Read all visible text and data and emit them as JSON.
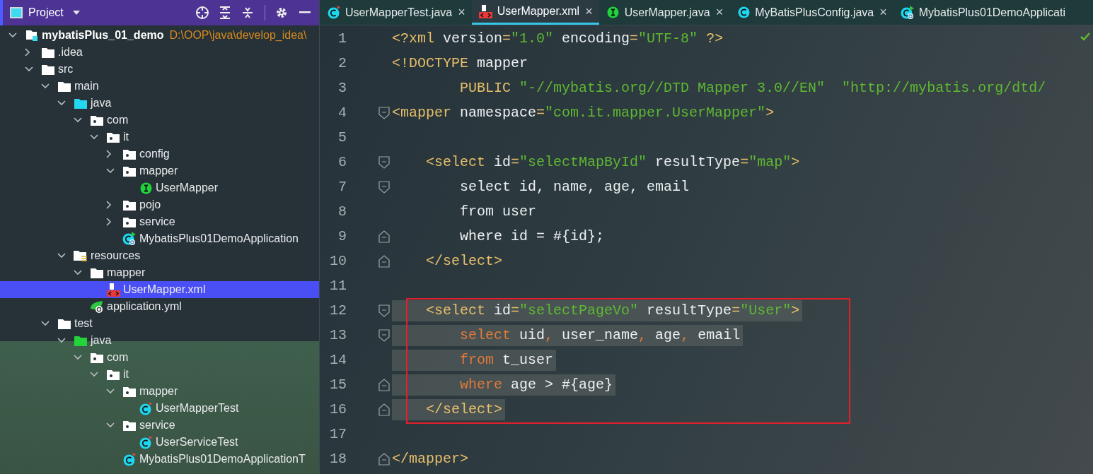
{
  "project_panel": {
    "title": "Project",
    "tree": [
      {
        "label": "mybatisPlus_01_demo",
        "path": "D:\\OOP\\java\\develop_idea\\",
        "kind": "project",
        "expanded": true,
        "selected": false,
        "children": [
          {
            "label": ".idea",
            "kind": "folder",
            "expanded": false,
            "selected": false
          },
          {
            "label": "src",
            "kind": "folder",
            "expanded": true,
            "selected": false,
            "children": [
              {
                "label": "main",
                "kind": "folder",
                "expanded": true,
                "selected": false,
                "children": [
                  {
                    "label": "java",
                    "kind": "source",
                    "expanded": true,
                    "selected": false,
                    "children": [
                      {
                        "label": "com",
                        "kind": "package",
                        "expanded": true,
                        "selected": false,
                        "children": [
                          {
                            "label": "it",
                            "kind": "package",
                            "expanded": true,
                            "selected": false,
                            "children": [
                              {
                                "label": "config",
                                "kind": "package",
                                "expanded": false,
                                "selected": false
                              },
                              {
                                "label": "mapper",
                                "kind": "package",
                                "expanded": true,
                                "selected": false,
                                "children": [
                                  {
                                    "label": "UserMapper",
                                    "kind": "interface",
                                    "selected": false
                                  }
                                ]
                              },
                              {
                                "label": "pojo",
                                "kind": "package",
                                "expanded": false,
                                "selected": false
                              },
                              {
                                "label": "service",
                                "kind": "package",
                                "expanded": false,
                                "selected": false
                              },
                              {
                                "label": "MybatisPlus01DemoApplication",
                                "kind": "app",
                                "selected": false
                              }
                            ]
                          }
                        ]
                      }
                    ]
                  },
                  {
                    "label": "resources",
                    "kind": "resources",
                    "expanded": true,
                    "selected": false,
                    "children": [
                      {
                        "label": "mapper",
                        "kind": "folder",
                        "expanded": true,
                        "selected": false,
                        "children": [
                          {
                            "label": "UserMapper.xml",
                            "kind": "xml",
                            "selected": true
                          }
                        ]
                      },
                      {
                        "label": "application.yml",
                        "kind": "yml",
                        "selected": false
                      }
                    ]
                  }
                ]
              },
              {
                "label": "test",
                "kind": "folder",
                "expanded": true,
                "selected": false,
                "children": [
                  {
                    "label": "java",
                    "kind": "test",
                    "expanded": true,
                    "selected": false,
                    "children": [
                      {
                        "label": "com",
                        "kind": "package",
                        "expanded": true,
                        "selected": false,
                        "children": [
                          {
                            "label": "it",
                            "kind": "package",
                            "expanded": true,
                            "selected": false,
                            "children": [
                              {
                                "label": "mapper",
                                "kind": "package",
                                "expanded": true,
                                "selected": false,
                                "children": [
                                  {
                                    "label": "UserMapperTest",
                                    "kind": "testclass",
                                    "selected": false
                                  }
                                ]
                              },
                              {
                                "label": "service",
                                "kind": "package",
                                "expanded": true,
                                "selected": false,
                                "children": [
                                  {
                                    "label": "UserServiceTest",
                                    "kind": "testclass",
                                    "selected": false
                                  }
                                ]
                              },
                              {
                                "label": "MybatisPlus01DemoApplicationT",
                                "kind": "testclass",
                                "selected": false
                              }
                            ]
                          }
                        ]
                      }
                    ]
                  }
                ]
              }
            ]
          }
        ]
      }
    ]
  },
  "editor_tabs": [
    {
      "label": "UserMapperTest.java",
      "kind": "testclass",
      "close": "×",
      "selected": false
    },
    {
      "label": "UserMapper.xml",
      "kind": "xml",
      "close": "×",
      "selected": true
    },
    {
      "label": "UserMapper.java",
      "kind": "interface",
      "close": "×",
      "selected": false
    },
    {
      "label": "MyBatisPlusConfig.java",
      "kind": "class",
      "close": "×",
      "selected": false
    },
    {
      "label": "MybatisPlus01DemoApplicati",
      "kind": "app",
      "selected": false
    }
  ],
  "editor": {
    "lines": [
      {
        "number": "1",
        "highlighted": false,
        "tokens": [
          {
            "kind": "tag",
            "text": "<?xml "
          },
          {
            "kind": "attr",
            "text": "version"
          },
          {
            "kind": "tag",
            "text": "="
          },
          {
            "kind": "str",
            "text": "\"1.0\""
          },
          {
            "kind": "attr",
            "text": " encoding"
          },
          {
            "kind": "tag",
            "text": "="
          },
          {
            "kind": "str",
            "text": "\"UTF-8\""
          },
          {
            "kind": "tag",
            "text": " ?>"
          }
        ]
      },
      {
        "number": "2",
        "highlighted": false,
        "tokens": [
          {
            "kind": "tag",
            "text": "<!DOCTYPE "
          },
          {
            "kind": "attr",
            "text": "mapper"
          }
        ]
      },
      {
        "number": "3",
        "highlighted": false,
        "tokens": [
          {
            "kind": "tag",
            "text": "        PUBLIC "
          },
          {
            "kind": "str",
            "text": "\"-//mybatis.org//DTD Mapper 3.0//EN\"  \"http://mybatis.org/dtd/"
          }
        ]
      },
      {
        "number": "4",
        "highlighted": false,
        "kind": "opener",
        "tokens": [
          {
            "kind": "tag",
            "text": "<mapper "
          },
          {
            "kind": "attr",
            "text": "namespace"
          },
          {
            "kind": "tag",
            "text": "="
          },
          {
            "kind": "str",
            "text": "\"com.it.mapper.UserMapper\""
          },
          {
            "kind": "tag",
            "text": ">"
          }
        ]
      },
      {
        "number": "5",
        "highlighted": false
      },
      {
        "number": "6",
        "highlighted": false,
        "kind": "opener",
        "tokens": [
          {
            "kind": "tag",
            "text": "    <select "
          },
          {
            "kind": "attr",
            "text": "id"
          },
          {
            "kind": "tag",
            "text": "="
          },
          {
            "kind": "str",
            "text": "\"selectMapById\""
          },
          {
            "kind": "attr",
            "text": " resultType"
          },
          {
            "kind": "tag",
            "text": "="
          },
          {
            "kind": "str",
            "text": "\"map\""
          },
          {
            "kind": "tag",
            "text": ">"
          }
        ]
      },
      {
        "number": "7",
        "highlighted": false,
        "kind": "opener",
        "tokens": [
          {
            "kind": "attr",
            "text": "        select id, name, age, email"
          }
        ]
      },
      {
        "number": "8",
        "highlighted": false,
        "tokens": [
          {
            "kind": "attr",
            "text": "        from user"
          }
        ]
      },
      {
        "number": "9",
        "highlighted": false,
        "kind": "closer",
        "tokens": [
          {
            "kind": "attr",
            "text": "        where id = #{id};"
          }
        ]
      },
      {
        "number": "10",
        "highlighted": false,
        "kind": "closer",
        "tokens": [
          {
            "kind": "tag",
            "text": "    </select>"
          }
        ]
      },
      {
        "number": "11",
        "highlighted": false
      },
      {
        "number": "12",
        "kind": "opener",
        "highlighted": true,
        "tokens": [
          {
            "kind": "tag",
            "text": "    <select "
          },
          {
            "kind": "attr",
            "text": "id"
          },
          {
            "kind": "tag",
            "text": "="
          },
          {
            "kind": "str",
            "text": "\"selectPageVo\""
          },
          {
            "kind": "attr",
            "text": " resultType"
          },
          {
            "kind": "tag",
            "text": "="
          },
          {
            "kind": "str",
            "text": "\"User\""
          },
          {
            "kind": "tag",
            "text": ">"
          }
        ]
      },
      {
        "number": "13",
        "kind": "opener",
        "highlighted": true,
        "tokens": [
          {
            "kind": "kw",
            "text": "        select "
          },
          {
            "kind": "attr",
            "text": "uid"
          },
          {
            "kind": "kw",
            "text": ", "
          },
          {
            "kind": "attr",
            "text": "user_name"
          },
          {
            "kind": "kw",
            "text": ", "
          },
          {
            "kind": "attr",
            "text": "age"
          },
          {
            "kind": "kw",
            "text": ", "
          },
          {
            "kind": "attr",
            "text": "email"
          }
        ]
      },
      {
        "number": "14",
        "highlighted": true,
        "tokens": [
          {
            "kind": "kw",
            "text": "        from "
          },
          {
            "kind": "attr",
            "text": "t_user"
          }
        ]
      },
      {
        "number": "15",
        "kind": "closer",
        "highlighted": true,
        "tokens": [
          {
            "kind": "kw",
            "text": "        where "
          },
          {
            "kind": "attr",
            "text": "age > #{age}"
          }
        ]
      },
      {
        "number": "16",
        "kind": "closer",
        "highlighted": true,
        "tokens": [
          {
            "kind": "tag",
            "text": "    </select>"
          }
        ]
      },
      {
        "number": "17",
        "highlighted": false
      },
      {
        "number": "18",
        "highlighted": false,
        "kind": "closer",
        "tokens": [
          {
            "kind": "tag",
            "text": "</mapper>"
          }
        ]
      }
    ]
  }
}
